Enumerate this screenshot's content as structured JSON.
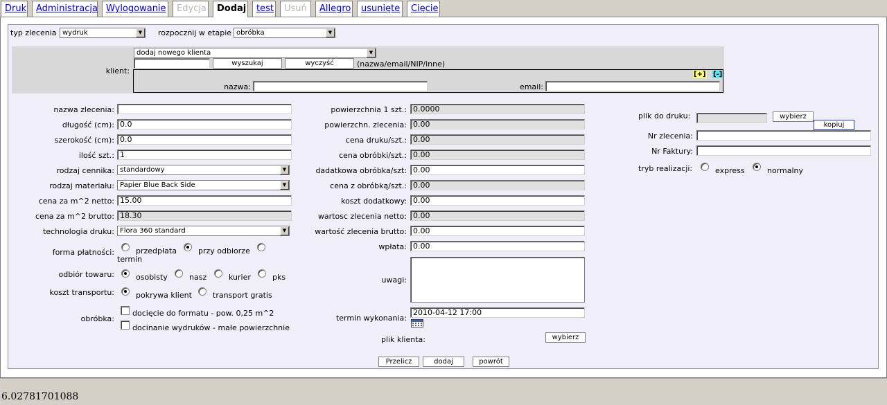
{
  "tabs": [
    {
      "label": "Druk",
      "state": "link"
    },
    {
      "label": "Administracja",
      "state": "link"
    },
    {
      "label": "Wylogowanie",
      "state": "link"
    },
    {
      "label": "Edycja",
      "state": "disabled"
    },
    {
      "label": "Dodaj",
      "state": "active"
    },
    {
      "label": "test",
      "state": "link"
    },
    {
      "label": "Usuń",
      "state": "disabled"
    },
    {
      "label": "Allegro",
      "state": "link"
    },
    {
      "label": "usunięte",
      "state": "link"
    },
    {
      "label": "Cięcie",
      "state": "link"
    }
  ],
  "top": {
    "typ_label": "typ zlecenia",
    "typ_value": "wydruk",
    "etap_label": "rozpocznij w etapie",
    "etap_value": "obróbka"
  },
  "klient": {
    "label": "klient:",
    "select_value": "dodaj nowego klienta",
    "search_value": "",
    "search_button": "wyszukaj",
    "clear_button": "wyczyść",
    "hint": "(nazwa/email/NIP/inne)",
    "expand": "[+]",
    "collapse": "[-]",
    "nazwa_label": "nazwa:",
    "email_label": "email:"
  },
  "col1": {
    "nazwa_zlecenia": {
      "label": "nazwa zlecenia:",
      "value": ""
    },
    "dlugosc": {
      "label": "długość (cm):",
      "value": "0.0"
    },
    "szerokosc": {
      "label": "szerokość (cm):",
      "value": "0.0"
    },
    "ilosc": {
      "label": "ilość szt.:",
      "value": "1"
    },
    "rodzaj_cennika": {
      "label": "rodzaj cennika:",
      "value": "standardowy"
    },
    "rodzaj_materialu": {
      "label": "rodzaj materiału:",
      "value": "Papier Blue Back Side"
    },
    "cena_netto": {
      "label": "cena za m^2 netto:",
      "value": "15.00"
    },
    "cena_brutto": {
      "label": "cena za m^2 brutto:",
      "value": "18.30"
    },
    "technologia": {
      "label": "technologia druku:",
      "value": "Flora 360 standard"
    },
    "forma_platnosci": {
      "label": "forma płatności:",
      "options": [
        "przedpłata",
        "przy odbiorze",
        "termin"
      ],
      "selected": "przy odbiorze"
    },
    "odbior": {
      "label": "odbiór towaru:",
      "options": [
        "osobisty",
        "nasz",
        "kurier",
        "pks"
      ],
      "selected": "osobisty"
    },
    "koszt_transportu": {
      "label": "koszt transportu:",
      "options": [
        "pokrywa klient",
        "transport gratis"
      ],
      "selected": "pokrywa klient"
    },
    "obrobka": {
      "label": "obróbka:",
      "options": [
        "docięcie do formatu - pow. 0,25 m^2",
        "docinanie wydruków - małe powierzchnie"
      ]
    }
  },
  "col2": {
    "powierzchnia_1": {
      "label": "powierzchnia 1 szt.:",
      "value": "0.0000"
    },
    "powierzchnia_zlec": {
      "label": "powierzchn. zlecenia:",
      "value": "0.00"
    },
    "cena_druku": {
      "label": "cena druku/szt.:",
      "value": "0.00"
    },
    "cena_obrobki": {
      "label": "cena obróbki/szt.:",
      "value": "0.00"
    },
    "dodatkowa_obrobka": {
      "label": "dadatkowa obróbka/szt:",
      "value": "0.00"
    },
    "cena_z_obrobka": {
      "label": "cena z obróbką/szt.:",
      "value": "0.00"
    },
    "koszt_dodatkowy": {
      "label": "koszt dodatkowy:",
      "value": "0.00"
    },
    "wartosc_netto": {
      "label": "wartosc zlecenia netto:",
      "value": "0.00"
    },
    "wartosc_brutto": {
      "label": "wartość zlecenia brutto:",
      "value": "0.00"
    },
    "wplata": {
      "label": "wpłata:",
      "value": "0.00"
    },
    "uwagi": {
      "label": "uwagi:",
      "value": ""
    },
    "termin": {
      "label": "termin wykonania:",
      "value": "2010-04-12 17:00"
    },
    "plik_klienta": {
      "label": "plik klienta:",
      "button": "wybierz"
    }
  },
  "col3": {
    "plik_do_druku": {
      "label": "plik do druku:",
      "button": "wybierz",
      "copy": "kopiuj"
    },
    "nr_zlecenia": {
      "label": "Nr zlecenia:",
      "value": ""
    },
    "nr_faktury": {
      "label": "Nr Faktury:",
      "value": ""
    },
    "tryb": {
      "label": "tryb realizacji:",
      "options": [
        "express",
        "normalny"
      ],
      "selected": "normalny"
    }
  },
  "actions": {
    "recalc": "Przelicz",
    "add": "dodaj",
    "back": "powrót"
  },
  "footer_text": "6.02781701088"
}
